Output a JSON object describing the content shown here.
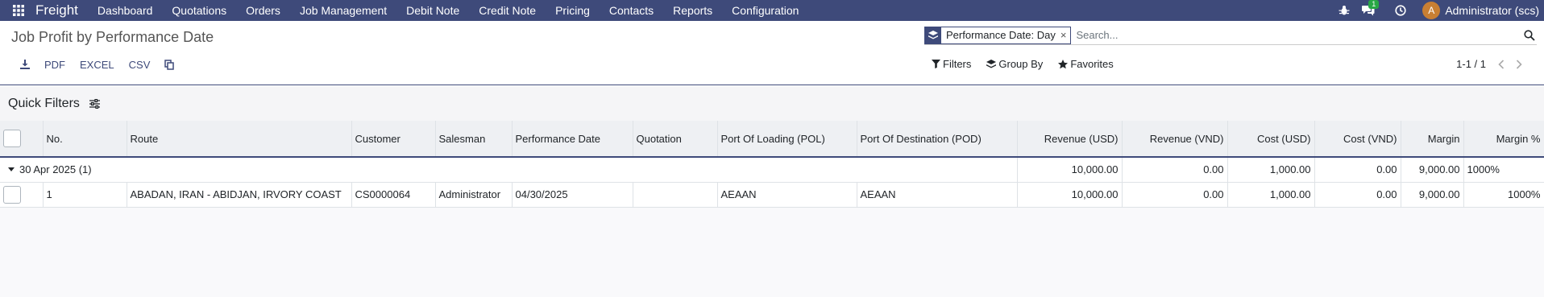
{
  "navbar": {
    "brand": "Freight",
    "menu": [
      "Dashboard",
      "Quotations",
      "Orders",
      "Job Management",
      "Debit Note",
      "Credit Note",
      "Pricing",
      "Contacts",
      "Reports",
      "Configuration"
    ],
    "messages_badge": "1",
    "user_initial": "A",
    "user_name": "Administrator (scs)"
  },
  "control": {
    "title": "Job Profit by Performance Date",
    "export": {
      "pdf": "PDF",
      "excel": "EXCEL",
      "csv": "CSV"
    },
    "facet": "Performance Date: Day",
    "facet_close": "×",
    "search_placeholder": "Search...",
    "filters": "Filters",
    "group_by": "Group By",
    "favorites": "Favorites",
    "pager": "1-1 / 1"
  },
  "quick_filters": {
    "title": "Quick Filters"
  },
  "table": {
    "headers": {
      "no": "No.",
      "route": "Route",
      "customer": "Customer",
      "salesman": "Salesman",
      "performance_date": "Performance Date",
      "quotation": "Quotation",
      "pol": "Port Of Loading (POL)",
      "pod": "Port Of Destination (POD)",
      "revenue_usd": "Revenue (USD)",
      "revenue_vnd": "Revenue (VND)",
      "cost_usd": "Cost (USD)",
      "cost_vnd": "Cost (VND)",
      "margin": "Margin",
      "margin_pct": "Margin %"
    },
    "group": {
      "label": "30 Apr 2025 (1)",
      "revenue_usd": "10,000.00",
      "revenue_vnd": "0.00",
      "cost_usd": "1,000.00",
      "cost_vnd": "0.00",
      "margin": "9,000.00",
      "margin_pct": "1000%"
    },
    "row": {
      "no": "1",
      "route": "ABADAN, IRAN - ABIDJAN, IRVORY COAST",
      "customer": "CS0000064",
      "salesman": "Administrator",
      "performance_date": "04/30/2025",
      "quotation": "",
      "pol": "AEAAN",
      "pod": "AEAAN",
      "revenue_usd": "10,000.00",
      "revenue_vnd": "0.00",
      "cost_usd": "1,000.00",
      "cost_vnd": "0.00",
      "margin": "9,000.00",
      "margin_pct": "1000%"
    }
  },
  "colors": {
    "navbar": "#3e4a7a",
    "badge": "#28a745",
    "avatar": "#c87f33"
  }
}
